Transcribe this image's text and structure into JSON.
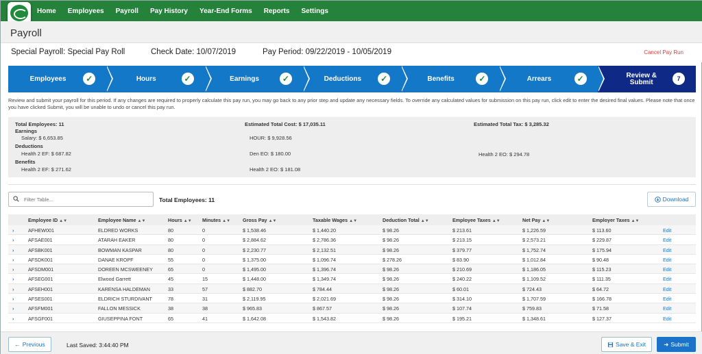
{
  "nav": {
    "items": [
      "Home",
      "Employees",
      "Payroll",
      "Pay History",
      "Year-End Forms",
      "Reports",
      "Settings"
    ]
  },
  "page": {
    "title": "Payroll",
    "payroll_name": "Special Payroll: Special Pay Roll",
    "check_date": "Check Date: 10/07/2019",
    "pay_period": "Pay Period: 09/22/2019 - 10/05/2019",
    "cancel_label": "Cancel Pay Run"
  },
  "stepper": {
    "steps": [
      {
        "label": "Employees",
        "status": "done"
      },
      {
        "label": "Hours",
        "status": "done"
      },
      {
        "label": "Earnings",
        "status": "done"
      },
      {
        "label": "Deductions",
        "status": "done"
      },
      {
        "label": "Benefits",
        "status": "done"
      },
      {
        "label": "Arrears",
        "status": "done"
      },
      {
        "label": "Review & Submit",
        "status": "active",
        "number": "7"
      }
    ]
  },
  "instructions": "Review and submit your payroll for this period. If any changes are required to properly calculate this pay run, you may go back to any prior step and update any necessary fields. To override any calculated values for submission on this pay run, click edit to enter the desired final values. Please note that once you have clicked Submit, you will be unable to undo or cancel this pay run.",
  "summary": {
    "total_employees": "Total Employees: 11",
    "total_cost": "Estimated Total Cost: $ 17,035.11",
    "total_tax": "Estimated Total Tax: $ 3,285.32",
    "earnings_heading": "Earnings",
    "salary": "Salary: $ 6,653.85",
    "hour": "HOUR: $ 9,928.56",
    "deductions_heading": "Deductions",
    "health2_ef_ded": "Health 2 EF: $ 687.82",
    "den_eo": "Den EO: $ 180.00",
    "health2_eo_ded": "Health 2 EO: $ 294.78",
    "benefits_heading": "Benefits",
    "health2_ef_ben": "Health 2 EF: $ 271.62",
    "health2_eo_ben": "Health 2 EO: $ 181.08"
  },
  "toolbar": {
    "filter_placeholder": "Filter Table...",
    "total_employees": "Total Employees: 11",
    "download_label": "Download"
  },
  "table": {
    "headers": [
      "Employee ID",
      "Employee Name",
      "Hours",
      "Minutes",
      "Gross Pay",
      "Taxable Wages",
      "Deduction Total",
      "Employee Taxes",
      "Net Pay",
      "Employer Taxes"
    ],
    "edit_label": "Edit",
    "rows": [
      [
        "AFHEW001",
        "ELDRED WORKS",
        "80",
        "0",
        "$ 1,538.46",
        "$ 1,440.20",
        "$ 98.26",
        "$ 213.61",
        "$ 1,226.59",
        "$ 113.60"
      ],
      [
        "AFSAE001",
        "ATARAH EAKER",
        "80",
        "0",
        "$ 2,884.62",
        "$ 2,786.36",
        "$ 98.26",
        "$ 213.15",
        "$ 2,573.21",
        "$ 229.87"
      ],
      [
        "AFSBK001",
        "BOWMAN KASPAR",
        "80",
        "0",
        "$ 2,230.77",
        "$ 2,132.51",
        "$ 98.26",
        "$ 379.77",
        "$ 1,752.74",
        "$ 175.94"
      ],
      [
        "AFSDK001",
        "DANAE KROPF",
        "55",
        "0",
        "$ 1,375.00",
        "$ 1,096.74",
        "$ 278.26",
        "$ 83.90",
        "$ 1,012.84",
        "$ 90.48"
      ],
      [
        "AFSDM001",
        "DOREEN MCSWEENEY",
        "65",
        "0",
        "$ 1,495.00",
        "$ 1,396.74",
        "$ 98.26",
        "$ 210.69",
        "$ 1,186.05",
        "$ 115.23"
      ],
      [
        "AFSEG001",
        "Elwood Garrett",
        "45",
        "15",
        "$ 1,448.00",
        "$ 1,349.74",
        "$ 98.26",
        "$ 240.22",
        "$ 1,109.52",
        "$ 111.35"
      ],
      [
        "AFSEH001",
        "KARENSA HALDEMAN",
        "33",
        "57",
        "$ 882.70",
        "$ 784.44",
        "$ 98.26",
        "$ 60.01",
        "$ 724.43",
        "$ 64.72"
      ],
      [
        "AFSES001",
        "ELDRICH STURDIVANT",
        "78",
        "31",
        "$ 2,119.95",
        "$ 2,021.69",
        "$ 98.26",
        "$ 314.10",
        "$ 1,707.59",
        "$ 166.78"
      ],
      [
        "AFSFM001",
        "FALLON MESSICK",
        "38",
        "38",
        "$ 965.83",
        "$ 867.57",
        "$ 98.26",
        "$ 107.74",
        "$ 759.83",
        "$ 71.58"
      ],
      [
        "AFSGF001",
        "GIUSEPPINA FONT",
        "65",
        "41",
        "$ 1,642.08",
        "$ 1,543.82",
        "$ 98.26",
        "$ 195.21",
        "$ 1,348.61",
        "$ 127.37"
      ]
    ]
  },
  "footer": {
    "previous_label": "Previous",
    "last_saved": "Last Saved: 3:44:40 PM",
    "save_exit_label": "Save & Exit",
    "submit_label": "Submit"
  },
  "colors": {
    "nav_green": "#24823a",
    "step_blue": "#1478c8",
    "step_active": "#0e2a86",
    "link_blue": "#1a73c8",
    "cancel_red": "#e0403a"
  }
}
